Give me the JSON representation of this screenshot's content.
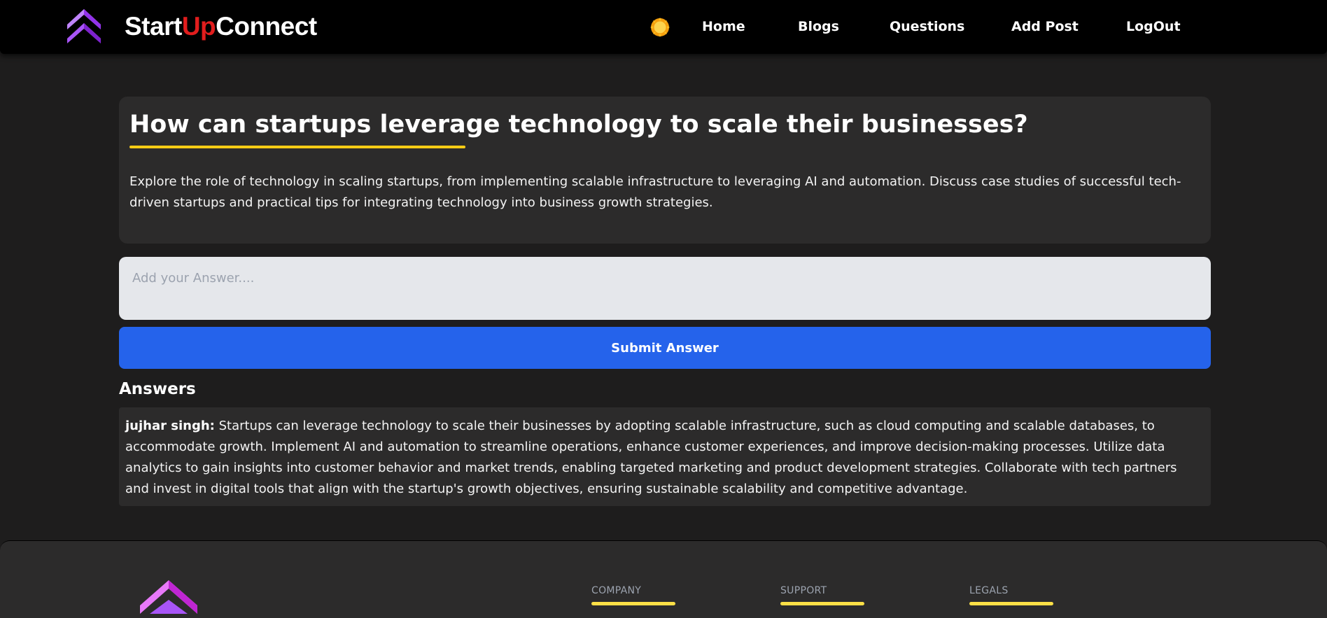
{
  "brand": {
    "part1": "Start",
    "part2": "Up",
    "part3": "Connect",
    "accent_color": "#e11d1d"
  },
  "nav": {
    "theme_icon": "sun-icon",
    "items": [
      {
        "label": "Home"
      },
      {
        "label": "Blogs"
      },
      {
        "label": "Questions"
      },
      {
        "label": "Add Post"
      },
      {
        "label": "LogOut"
      }
    ]
  },
  "question": {
    "title": "How can startups leverage technology to scale their businesses?",
    "description": "Explore the role of technology in scaling startups, from implementing scalable infrastructure to leveraging AI and automation. Discuss case studies of successful tech-driven startups and practical tips for integrating technology into business growth strategies.",
    "underline_color": "#facc15"
  },
  "answer_form": {
    "placeholder": "Add your Answer....",
    "value": "",
    "submit_label": "Submit Answer",
    "button_color": "#2563eb"
  },
  "answers": {
    "heading": "Answers",
    "items": [
      {
        "author": "jujhar singh:",
        "text": " Startups can leverage technology to scale their businesses by adopting scalable infrastructure, such as cloud computing and scalable databases, to accommodate growth. Implement AI and automation to streamline operations, enhance customer experiences, and improve decision-making processes. Utilize data analytics to gain insights into customer behavior and market trends, enabling targeted marketing and product development strategies. Collaborate with tech partners and invest in digital tools that align with the startup's growth objectives, ensuring sustainable scalability and competitive advantage."
      }
    ]
  },
  "footer": {
    "columns": [
      {
        "title": "COMPANY"
      },
      {
        "title": "SUPPORT"
      },
      {
        "title": "LEGALS"
      }
    ],
    "accent_color": "#fde047"
  }
}
